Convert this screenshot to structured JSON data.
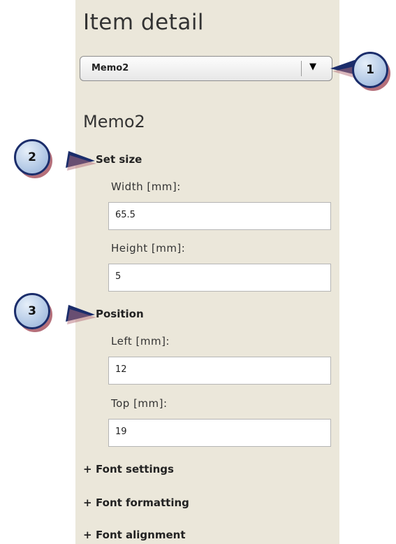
{
  "panel": {
    "title": "Item detail",
    "selector": {
      "selected": "Memo2",
      "arrow": "▼"
    },
    "item_name": "Memo2"
  },
  "sections": {
    "set_size": {
      "toggle": "−",
      "label": "Set size",
      "width_label": "Width [mm]:",
      "width_value": "65.5",
      "height_label": "Height [mm]:",
      "height_value": "5"
    },
    "position": {
      "toggle": "−",
      "label": "Position",
      "left_label": "Left [mm]:",
      "left_value": "12",
      "top_label": "Top [mm]:",
      "top_value": "19"
    },
    "font_settings": {
      "toggle": "+",
      "label": "Font settings"
    },
    "font_formatting": {
      "toggle": "+",
      "label": "Font formatting"
    },
    "font_alignment": {
      "toggle": "+",
      "label": "Font alignment"
    }
  },
  "callouts": [
    "1",
    "2",
    "3"
  ],
  "colors": {
    "panel_bg": "#ebe7da",
    "callout_fill": "#b3c9e6",
    "callout_border": "#1b2d6b",
    "callout_shadow": "#b56f7a"
  }
}
